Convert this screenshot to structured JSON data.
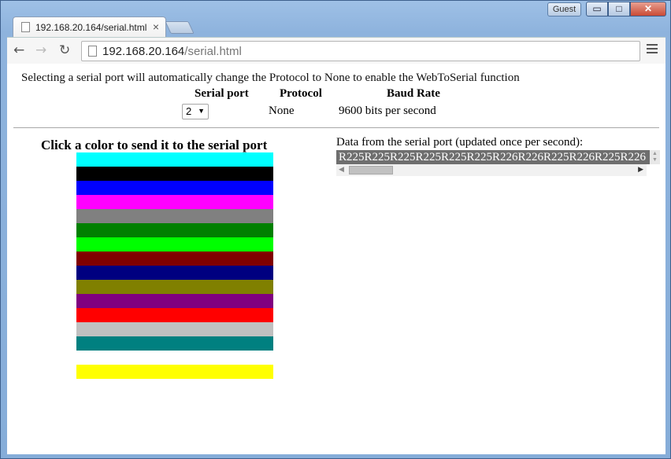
{
  "browser": {
    "tab_title": "192.168.20.164/serial.html",
    "tab_close": "×",
    "user_badge": "Guest",
    "min_label": "▭",
    "max_label": "□",
    "close_label": "✕",
    "back_icon": "←",
    "forward_icon": "→",
    "reload_icon": "↻",
    "url_host": "192.168.20.164",
    "url_path": "/serial.html"
  },
  "page": {
    "intro": "Selecting a serial port will automatically change the Protocol to None to enable the WebToSerial function",
    "headers": {
      "serial_port": "Serial port",
      "protocol": "Protocol",
      "baud_rate": "Baud Rate"
    },
    "values": {
      "serial_port": "2",
      "protocol": "None",
      "baud_rate": "9600 bits per second"
    },
    "color_title": "Click a color to send it to the serial port",
    "colors": [
      "#00ffff",
      "#000000",
      "#0000ff",
      "#ff00ff",
      "#808080",
      "#008000",
      "#00ff00",
      "#800000",
      "#000080",
      "#808000",
      "#800080",
      "#ff0000",
      "#c0c0c0",
      "#008080",
      "#ffffff",
      "#ffff00"
    ],
    "data_label": "Data from the serial port (updated once per second):",
    "data_text": "R225R225R225R225R225R225R226R226R225R226R225R226"
  }
}
